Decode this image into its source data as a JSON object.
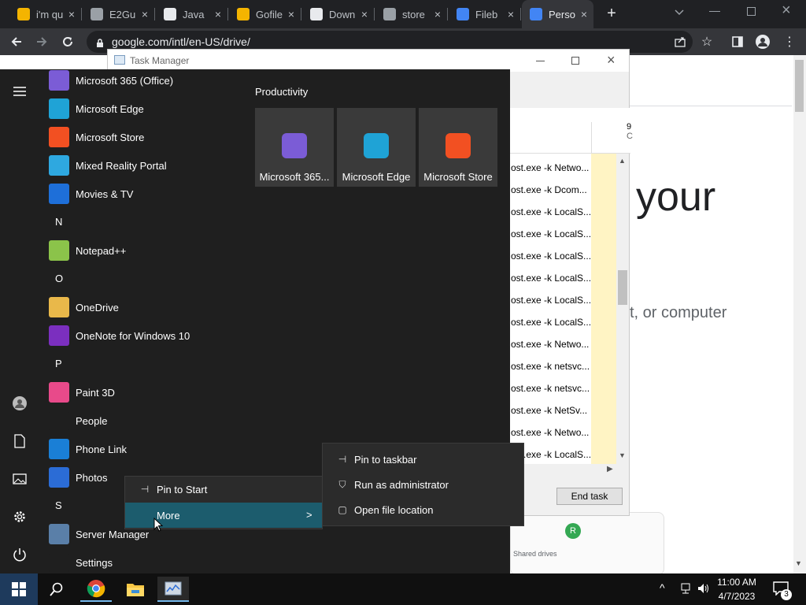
{
  "browser": {
    "tabs": [
      {
        "title": "i'm qu",
        "color": "#f4b400"
      },
      {
        "title": "E2Gu",
        "color": "#9aa0a6"
      },
      {
        "title": "Java",
        "color": "#e8eaed"
      },
      {
        "title": "Gofile",
        "color": "#f4b400"
      },
      {
        "title": "Down",
        "color": "#e8eaed"
      },
      {
        "title": "store",
        "color": "#9aa0a6"
      },
      {
        "title": "Fileb",
        "color": "#4285f4"
      },
      {
        "title": "Perso",
        "color": "#4285f4"
      }
    ],
    "new_tab": "+",
    "url": "google.com/intl/en-US/drive/"
  },
  "page": {
    "heading_fragment": "your",
    "sub_fragment": "t, or computer",
    "shared_drives": "Shared drives",
    "avatar_letter": "R"
  },
  "task_manager": {
    "title": "Task Manager",
    "col_header_1": "9",
    "col_header_2": "C",
    "rows": [
      "ost.exe -k Netwo...",
      "ost.exe -k Dcom...",
      "ost.exe -k LocalS...",
      "ost.exe -k LocalS...",
      "ost.exe -k LocalS...",
      "ost.exe -k LocalS...",
      "ost.exe -k LocalS...",
      "ost.exe -k LocalS...",
      "ost.exe -k Netwo...",
      "ost.exe -k netsvc...",
      "ost.exe -k netsvc...",
      "ost.exe -k NetSv...",
      "ost.exe -k Netwo...",
      "ost.exe -k LocalS..."
    ],
    "end_task": "End task"
  },
  "start_menu": {
    "apps": [
      {
        "type": "app",
        "label": "Microsoft 365 (Office)",
        "icon": "office-icon",
        "color": "#7b5cd6"
      },
      {
        "type": "app",
        "label": "Microsoft Edge",
        "icon": "edge-icon",
        "color": "#1fa3d6"
      },
      {
        "type": "app",
        "label": "Microsoft Store",
        "icon": "store-icon",
        "color": "#f25022"
      },
      {
        "type": "app",
        "label": "Mixed Reality Portal",
        "icon": "mixed-reality-icon",
        "color": "#2ea8e0"
      },
      {
        "type": "app",
        "label": "Movies & TV",
        "icon": "movies-icon",
        "color": "#1e6fd9"
      },
      {
        "type": "letter",
        "label": "N"
      },
      {
        "type": "app",
        "label": "Notepad++",
        "icon": "notepadpp-icon",
        "color": "#8bc34a"
      },
      {
        "type": "letter",
        "label": "O"
      },
      {
        "type": "app",
        "label": "OneDrive",
        "icon": "onedrive-folder-icon",
        "color": "#e9b84a"
      },
      {
        "type": "app",
        "label": "OneNote for Windows 10",
        "icon": "onenote-icon",
        "color": "#7b2fbf"
      },
      {
        "type": "letter",
        "label": "P"
      },
      {
        "type": "app",
        "label": "Paint 3D",
        "icon": "paint3d-icon",
        "color": "#e84a8a"
      },
      {
        "type": "app",
        "label": "People",
        "icon": "people-icon",
        "color": "#1f1f1f"
      },
      {
        "type": "app",
        "label": "Phone Link",
        "icon": "phone-link-icon",
        "color": "#1a7fd6"
      },
      {
        "type": "app",
        "label": "Photos",
        "icon": "photos-icon",
        "color": "#2b6cd6"
      },
      {
        "type": "letter",
        "label": "S"
      },
      {
        "type": "app",
        "label": "Server Manager",
        "icon": "server-manager-icon",
        "color": "#5a7fa8"
      },
      {
        "type": "app",
        "label": "Settings",
        "icon": "gear-icon",
        "color": "#1f1f1f"
      }
    ],
    "group_title": "Productivity",
    "tiles": [
      {
        "label": "Microsoft 365...",
        "icon": "office-icon",
        "color": "#7b5cd6"
      },
      {
        "label": "Microsoft Edge",
        "icon": "edge-icon",
        "color": "#1fa3d6"
      },
      {
        "label": "Microsoft Store",
        "icon": "store-icon",
        "color": "#f25022"
      }
    ]
  },
  "context_menu": {
    "pin_to_start": "Pin to Start",
    "more": "More",
    "more_arrow": ">"
  },
  "submenu": {
    "items": [
      {
        "label": "Pin to taskbar",
        "icon": "pin-icon"
      },
      {
        "label": "Run as administrator",
        "icon": "shield-icon"
      },
      {
        "label": "Open file location",
        "icon": "file-icon"
      }
    ]
  },
  "taskbar": {
    "time": "11:00 AM",
    "date": "4/7/2023",
    "notification_count": "3"
  }
}
